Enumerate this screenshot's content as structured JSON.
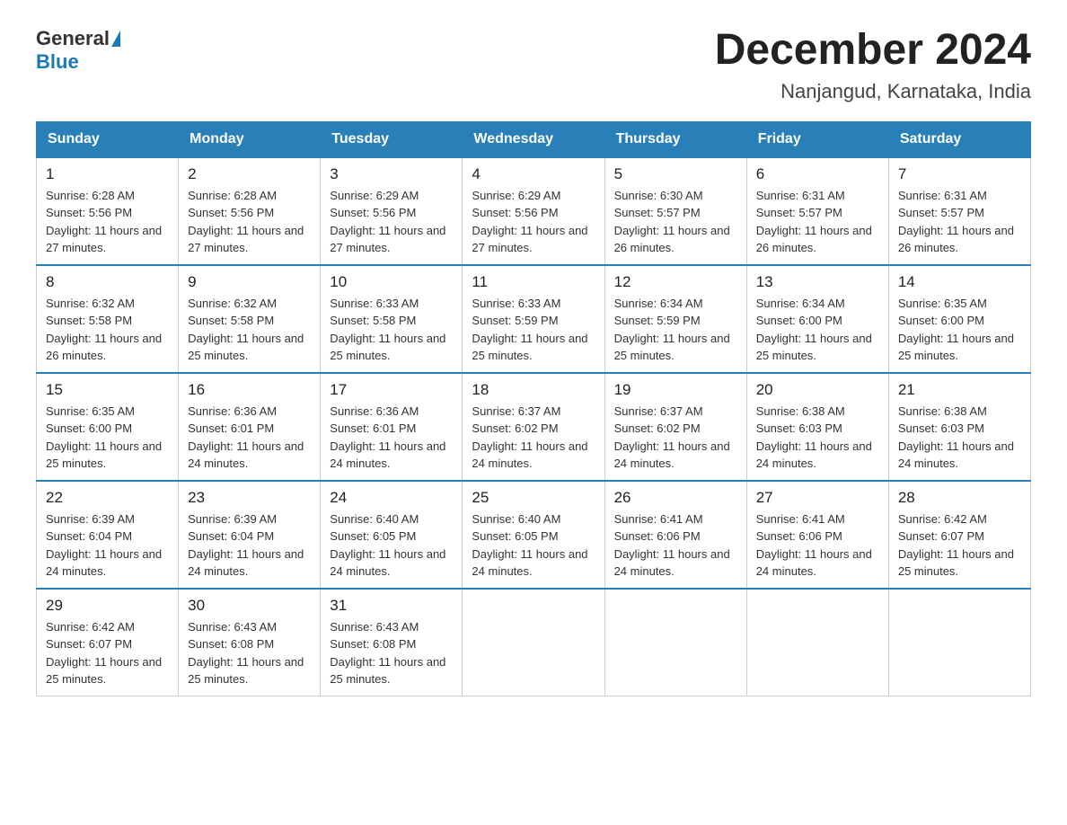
{
  "header": {
    "logo_general": "General",
    "logo_blue": "Blue",
    "month_title": "December 2024",
    "location": "Nanjangud, Karnataka, India"
  },
  "days_of_week": [
    "Sunday",
    "Monday",
    "Tuesday",
    "Wednesday",
    "Thursday",
    "Friday",
    "Saturday"
  ],
  "weeks": [
    [
      {
        "day": "1",
        "sunrise": "6:28 AM",
        "sunset": "5:56 PM",
        "daylight": "11 hours and 27 minutes."
      },
      {
        "day": "2",
        "sunrise": "6:28 AM",
        "sunset": "5:56 PM",
        "daylight": "11 hours and 27 minutes."
      },
      {
        "day": "3",
        "sunrise": "6:29 AM",
        "sunset": "5:56 PM",
        "daylight": "11 hours and 27 minutes."
      },
      {
        "day": "4",
        "sunrise": "6:29 AM",
        "sunset": "5:56 PM",
        "daylight": "11 hours and 27 minutes."
      },
      {
        "day": "5",
        "sunrise": "6:30 AM",
        "sunset": "5:57 PM",
        "daylight": "11 hours and 26 minutes."
      },
      {
        "day": "6",
        "sunrise": "6:31 AM",
        "sunset": "5:57 PM",
        "daylight": "11 hours and 26 minutes."
      },
      {
        "day": "7",
        "sunrise": "6:31 AM",
        "sunset": "5:57 PM",
        "daylight": "11 hours and 26 minutes."
      }
    ],
    [
      {
        "day": "8",
        "sunrise": "6:32 AM",
        "sunset": "5:58 PM",
        "daylight": "11 hours and 26 minutes."
      },
      {
        "day": "9",
        "sunrise": "6:32 AM",
        "sunset": "5:58 PM",
        "daylight": "11 hours and 25 minutes."
      },
      {
        "day": "10",
        "sunrise": "6:33 AM",
        "sunset": "5:58 PM",
        "daylight": "11 hours and 25 minutes."
      },
      {
        "day": "11",
        "sunrise": "6:33 AM",
        "sunset": "5:59 PM",
        "daylight": "11 hours and 25 minutes."
      },
      {
        "day": "12",
        "sunrise": "6:34 AM",
        "sunset": "5:59 PM",
        "daylight": "11 hours and 25 minutes."
      },
      {
        "day": "13",
        "sunrise": "6:34 AM",
        "sunset": "6:00 PM",
        "daylight": "11 hours and 25 minutes."
      },
      {
        "day": "14",
        "sunrise": "6:35 AM",
        "sunset": "6:00 PM",
        "daylight": "11 hours and 25 minutes."
      }
    ],
    [
      {
        "day": "15",
        "sunrise": "6:35 AM",
        "sunset": "6:00 PM",
        "daylight": "11 hours and 25 minutes."
      },
      {
        "day": "16",
        "sunrise": "6:36 AM",
        "sunset": "6:01 PM",
        "daylight": "11 hours and 24 minutes."
      },
      {
        "day": "17",
        "sunrise": "6:36 AM",
        "sunset": "6:01 PM",
        "daylight": "11 hours and 24 minutes."
      },
      {
        "day": "18",
        "sunrise": "6:37 AM",
        "sunset": "6:02 PM",
        "daylight": "11 hours and 24 minutes."
      },
      {
        "day": "19",
        "sunrise": "6:37 AM",
        "sunset": "6:02 PM",
        "daylight": "11 hours and 24 minutes."
      },
      {
        "day": "20",
        "sunrise": "6:38 AM",
        "sunset": "6:03 PM",
        "daylight": "11 hours and 24 minutes."
      },
      {
        "day": "21",
        "sunrise": "6:38 AM",
        "sunset": "6:03 PM",
        "daylight": "11 hours and 24 minutes."
      }
    ],
    [
      {
        "day": "22",
        "sunrise": "6:39 AM",
        "sunset": "6:04 PM",
        "daylight": "11 hours and 24 minutes."
      },
      {
        "day": "23",
        "sunrise": "6:39 AM",
        "sunset": "6:04 PM",
        "daylight": "11 hours and 24 minutes."
      },
      {
        "day": "24",
        "sunrise": "6:40 AM",
        "sunset": "6:05 PM",
        "daylight": "11 hours and 24 minutes."
      },
      {
        "day": "25",
        "sunrise": "6:40 AM",
        "sunset": "6:05 PM",
        "daylight": "11 hours and 24 minutes."
      },
      {
        "day": "26",
        "sunrise": "6:41 AM",
        "sunset": "6:06 PM",
        "daylight": "11 hours and 24 minutes."
      },
      {
        "day": "27",
        "sunrise": "6:41 AM",
        "sunset": "6:06 PM",
        "daylight": "11 hours and 24 minutes."
      },
      {
        "day": "28",
        "sunrise": "6:42 AM",
        "sunset": "6:07 PM",
        "daylight": "11 hours and 25 minutes."
      }
    ],
    [
      {
        "day": "29",
        "sunrise": "6:42 AM",
        "sunset": "6:07 PM",
        "daylight": "11 hours and 25 minutes."
      },
      {
        "day": "30",
        "sunrise": "6:43 AM",
        "sunset": "6:08 PM",
        "daylight": "11 hours and 25 minutes."
      },
      {
        "day": "31",
        "sunrise": "6:43 AM",
        "sunset": "6:08 PM",
        "daylight": "11 hours and 25 minutes."
      },
      null,
      null,
      null,
      null
    ]
  ]
}
